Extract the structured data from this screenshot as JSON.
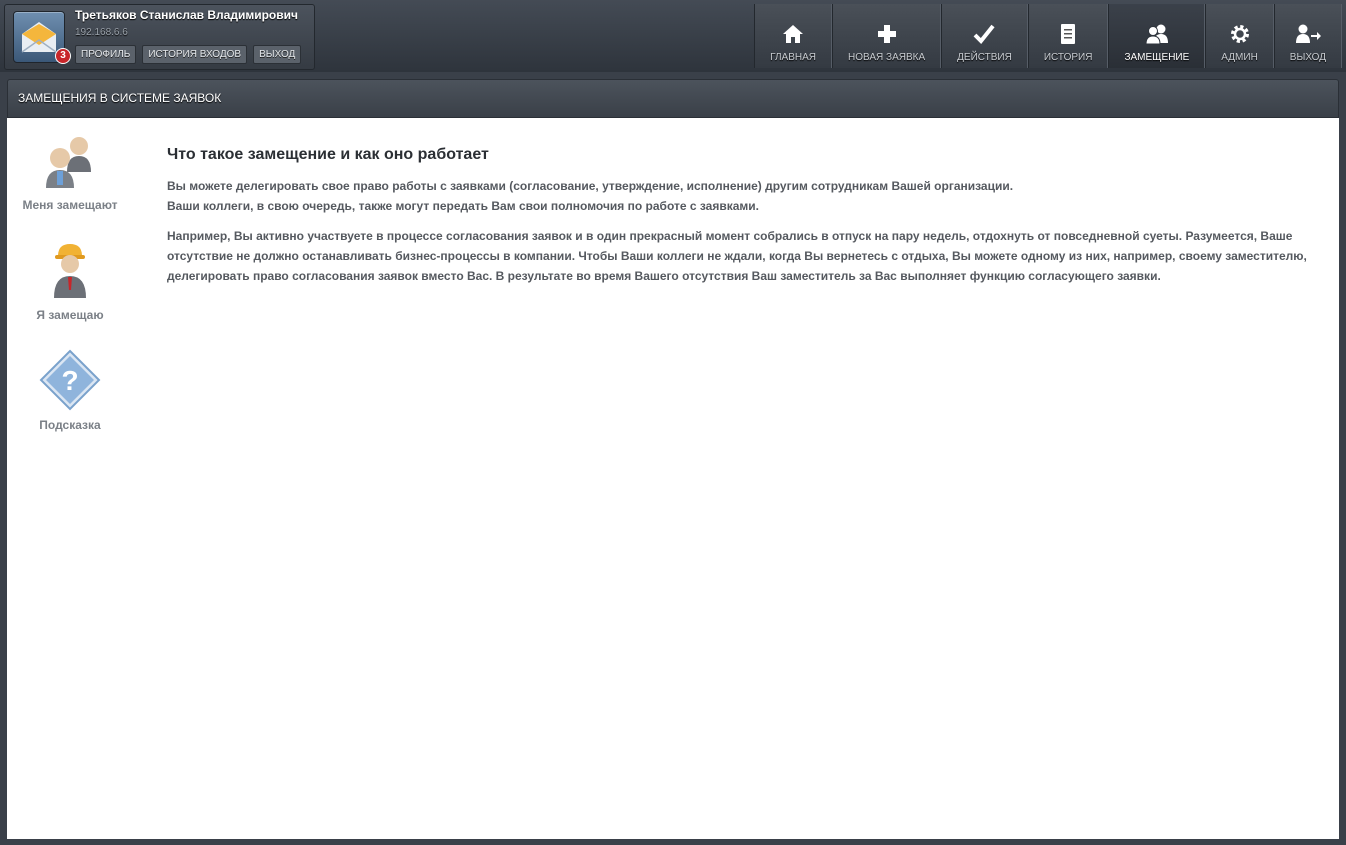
{
  "user": {
    "name": "Третьяков Станислав Владимирович",
    "ip": "192.168.6.6",
    "badge_count": "3",
    "links": [
      "ПРОФИЛЬ",
      "ИСТОРИЯ ВХОДОВ",
      "ВЫХОД"
    ]
  },
  "nav": [
    {
      "label": "ГЛАВНАЯ",
      "icon": "home-icon"
    },
    {
      "label": "НОВАЯ ЗАЯВКА",
      "icon": "plus-icon"
    },
    {
      "label": "ДЕЙСТВИЯ",
      "icon": "check-icon"
    },
    {
      "label": "ИСТОРИЯ",
      "icon": "document-icon"
    },
    {
      "label": "ЗАМЕЩЕНИЕ",
      "icon": "users-icon",
      "active": true
    },
    {
      "label": "АДМИН",
      "icon": "gear-icon"
    },
    {
      "label": "ВЫХОД",
      "icon": "logout-user-icon"
    }
  ],
  "section": {
    "title": "ЗАМЕЩЕНИЯ В СИСТЕМЕ ЗАЯВОК"
  },
  "sidebar": [
    {
      "label": "Меня замещают",
      "icon": "substitutes-icon"
    },
    {
      "label": "Я замещаю",
      "icon": "worker-icon"
    },
    {
      "label": "Подсказка",
      "icon": "help-icon"
    }
  ],
  "main": {
    "title": "Что такое замещение и как оно работает",
    "paragraph1_line1": "Вы можете делегировать свое право работы с заявками (согласование, утверждение, исполнение) другим сотрудникам Вашей организации.",
    "paragraph1_line2": "Ваши коллеги, в свою очередь, также могут передать Вам свои полномочия по работе с заявками.",
    "paragraph2": "Например, Вы активно участвуете в процессе согласования заявок и в один прекрасный момент собрались в отпуск на пару недель, отдохнуть от повседневной суеты. Разумеется, Ваше отсутствие не должно останавливать бизнес-процессы в компании. Чтобы Ваши коллеги не ждали, когда Вы вернетесь с отдыха, Вы можете одному из них, например, своему заместителю, делегировать право согласования заявок вместо Вас. В результате во время Вашего отсутствия Ваш заместитель за Вас выполняет функцию согласующего заявки."
  }
}
